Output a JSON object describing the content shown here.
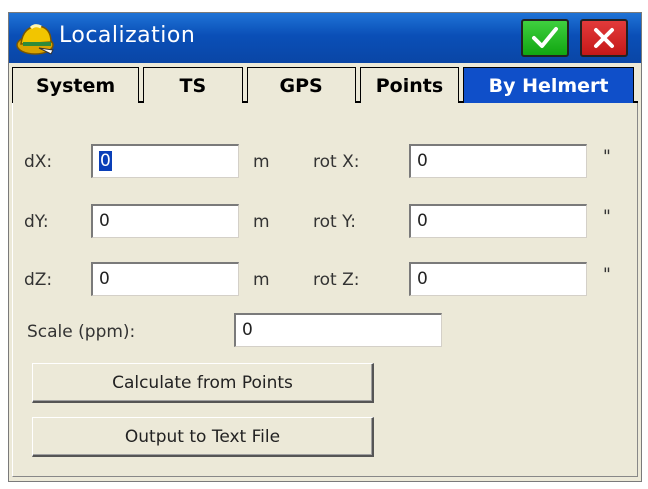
{
  "window": {
    "title": "Localization",
    "ok_icon": "checkmark-icon",
    "close_icon": "close-icon",
    "app_icon": "surveyor-helmet-icon"
  },
  "tabs": [
    {
      "label": "System",
      "active": false
    },
    {
      "label": "TS",
      "active": false
    },
    {
      "label": "GPS",
      "active": false
    },
    {
      "label": "Points",
      "active": false
    },
    {
      "label": "By Helmert",
      "active": true
    }
  ],
  "form": {
    "dx": {
      "label": "dX:",
      "value": "0",
      "unit": "m"
    },
    "dy": {
      "label": "dY:",
      "value": "0",
      "unit": "m"
    },
    "dz": {
      "label": "dZ:",
      "value": "0",
      "unit": "m"
    },
    "rotx": {
      "label": "rot X:",
      "value": "0",
      "unit": "\""
    },
    "roty": {
      "label": "rot Y:",
      "value": "0",
      "unit": "\""
    },
    "rotz": {
      "label": "rot Z:",
      "value": "0",
      "unit": "\""
    },
    "scale": {
      "label": "Scale (ppm):",
      "value": "0"
    }
  },
  "buttons": {
    "calculate": "Calculate from Points",
    "output": "Output to Text File"
  },
  "colors": {
    "titlebar": "#0a4fb7",
    "active_tab": "#0f4fc9",
    "ok": "#11a611",
    "close": "#c51818",
    "panel": "#ece9d8"
  }
}
